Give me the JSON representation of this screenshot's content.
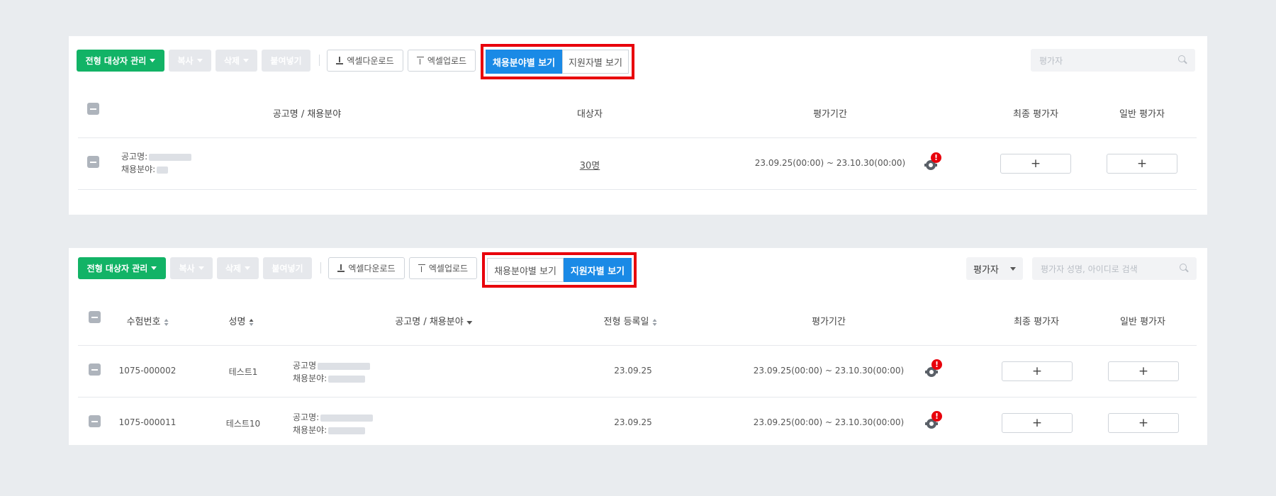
{
  "toolbar": {
    "manage_label": "전형 대상자 관리",
    "copy_label": "복사",
    "delete_label": "삭제",
    "paste_label": "붙여넣기",
    "excel_download_label": "엑셀다운로드",
    "excel_upload_label": "엑셀업로드"
  },
  "view_toggle": {
    "by_field_label": "채용분야별 보기",
    "by_applicant_label": "지원자별 보기"
  },
  "panel1": {
    "search_placeholder": "평가자",
    "headers": {
      "posting": "공고명 / 채용분야",
      "targets": "대상자",
      "period": "평가기간",
      "final_evaluator": "최종 평가자",
      "general_evaluator": "일반 평가자"
    },
    "rows": [
      {
        "posting_prefix": "공고명:",
        "field_prefix": "채용분야:",
        "targets": "30명",
        "period": "23.09.25(00:00) ~ 23.10.30(00:00)",
        "alert": "!",
        "final_add": "+",
        "general_add": "+"
      }
    ]
  },
  "panel2": {
    "filter_select": "평가자",
    "search_placeholder": "평가자 성명, 아이디로 검색",
    "headers": {
      "exam_no": "수험번호",
      "name": "성명",
      "posting": "공고명 / 채용분야",
      "reg_date": "전형 등록일",
      "period": "평가기간",
      "final_evaluator": "최종 평가자",
      "general_evaluator": "일반 평가자"
    },
    "rows": [
      {
        "exam_no": "1075-000002",
        "name": "테스트1",
        "posting_prefix": "공고명",
        "field_prefix": "채용분야:",
        "reg_date": "23.09.25",
        "period": "23.09.25(00:00) ~ 23.10.30(00:00)",
        "alert": "!",
        "final_add": "+",
        "general_add": "+"
      },
      {
        "exam_no": "1075-000011",
        "name": "테스트10",
        "posting_prefix": "공고명:",
        "field_prefix": "채용분야:",
        "reg_date": "23.09.25",
        "period": "23.09.25(00:00) ~ 23.10.30(00:00)",
        "alert": "!",
        "final_add": "+",
        "general_add": "+"
      }
    ]
  }
}
